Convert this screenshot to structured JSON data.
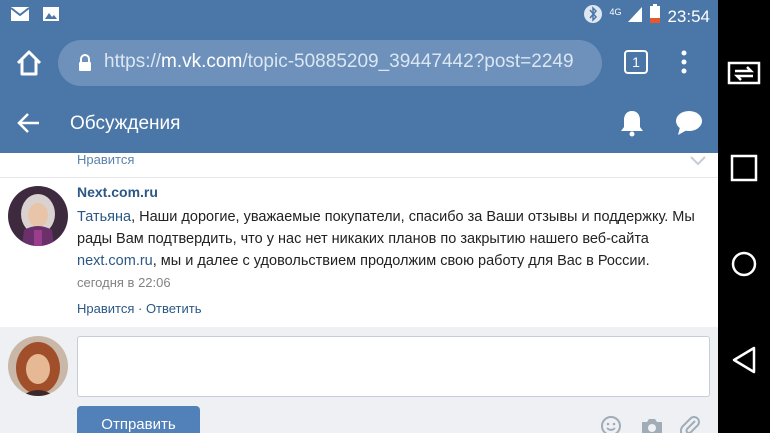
{
  "status_bar": {
    "time": "23:54",
    "network": "4G",
    "icons": [
      "mail-icon",
      "image-icon",
      "bluetooth-icon",
      "signal-icon",
      "battery-icon"
    ]
  },
  "browser": {
    "url_prefix": "https://",
    "url_host": "m.vk.com",
    "url_path": "/topic-50885209_39447442?post=2249",
    "tab_count": "1"
  },
  "header": {
    "title": "Обсуждения"
  },
  "previous_post": {
    "like_label": "Нравится"
  },
  "post": {
    "author": "Next.com.ru",
    "mention": "Татьяна",
    "text_part1": ", Наши дорогие, уважаемые покупатели, спасибо за Ваши отзывы и поддержку. Мы рады Вам подтвердить, что у нас нет никаких планов по закрытию нашего веб-сайта ",
    "link": "next.com.ru",
    "text_part2": ", мы и далее с удовольствием продолжим свою работу для Вас в России.",
    "time": "сегодня в 22:06",
    "like_label": "Нравится",
    "separator": " · ",
    "reply_label": "Ответить"
  },
  "compose": {
    "input_value": "",
    "send_label": "Отправить",
    "tools": [
      "emoji-icon",
      "camera-icon",
      "attach-icon"
    ]
  },
  "colors": {
    "header_bg": "#4a76a8",
    "link": "#2a5885",
    "button": "#5181b8"
  }
}
